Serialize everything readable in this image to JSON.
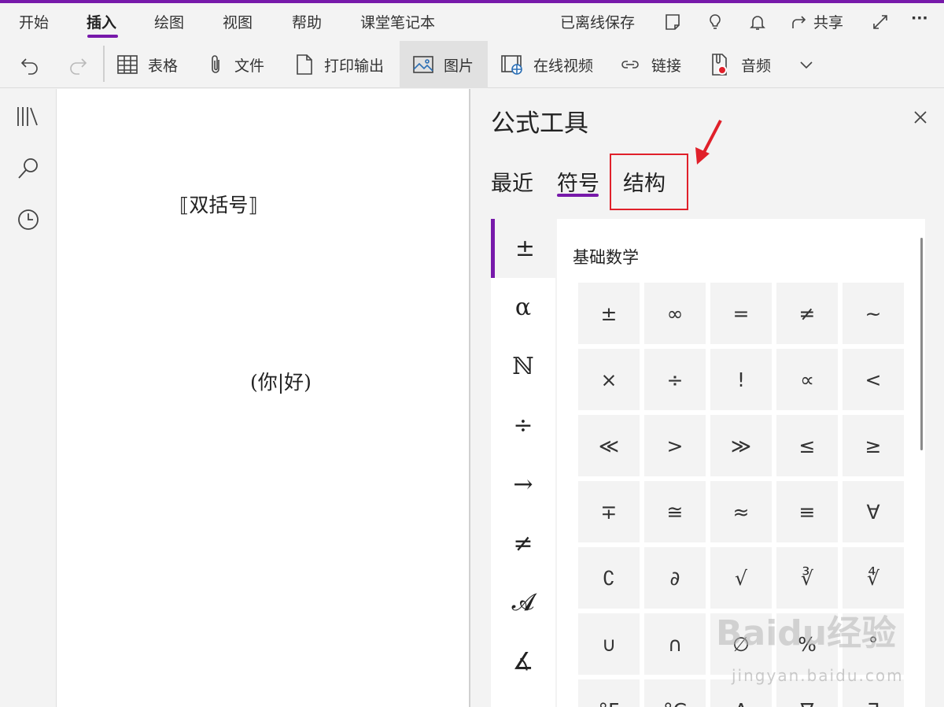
{
  "menu": {
    "items": [
      "开始",
      "插入",
      "绘图",
      "视图",
      "帮助",
      "课堂笔记本"
    ],
    "active_index": 1
  },
  "right_tools": {
    "status": "已离线保存",
    "share": "共享",
    "more": "···"
  },
  "ribbon": {
    "table": "表格",
    "file": "文件",
    "printout": "打印输出",
    "picture": "图片",
    "online_video": "在线视频",
    "link": "链接",
    "audio": "音频"
  },
  "canvas": {
    "eq1": "⟦双括号⟧",
    "eq2": "(你|好)"
  },
  "panel": {
    "title": "公式工具",
    "tabs": [
      "最近",
      "符号",
      "结构"
    ],
    "active_tab": 1,
    "highlighted_tab": 2,
    "section_title": "基础数学",
    "categories": [
      "±",
      "α",
      "ℕ",
      "÷",
      "→",
      "≠",
      "𝓐",
      "∡"
    ],
    "symbols": [
      [
        "±",
        "∞",
        "=",
        "≠",
        "~"
      ],
      [
        "×",
        "÷",
        "!",
        "∝",
        "<"
      ],
      [
        "≪",
        ">",
        "≫",
        "≤",
        "≥"
      ],
      [
        "∓",
        "≅",
        "≈",
        "≡",
        "∀"
      ],
      [
        "∁",
        "∂",
        "√",
        "∛",
        "∜"
      ],
      [
        "∪",
        "∩",
        "∅",
        "%",
        "°"
      ],
      [
        "°F",
        "°C",
        "∆",
        "∇",
        "∃"
      ]
    ]
  },
  "colors": {
    "accent": "#7719aa",
    "annotation": "#e0202a"
  },
  "watermark": {
    "main": "Baidu经验",
    "sub": "jingyan.baidu.com"
  }
}
